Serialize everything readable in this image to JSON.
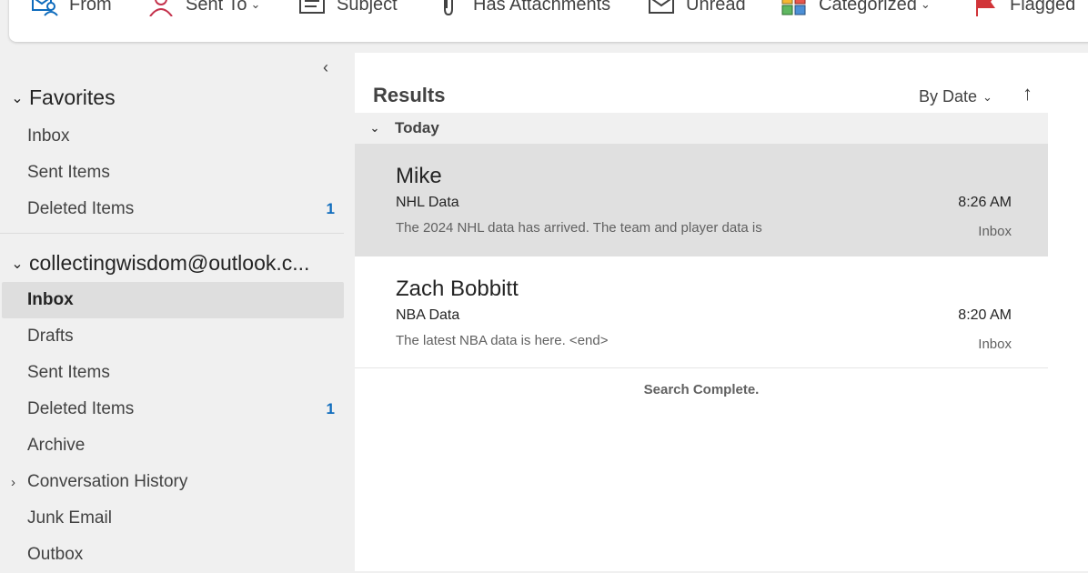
{
  "toolbar": {
    "filters": [
      {
        "label": "From",
        "icon": "from-icon"
      },
      {
        "label": "Sent To",
        "icon": "person-icon",
        "dropdown": true
      },
      {
        "label": "Subject",
        "icon": "subject-icon"
      },
      {
        "label": "Has Attachments",
        "icon": "paperclip-icon"
      },
      {
        "label": "Unread",
        "icon": "envelope-icon"
      },
      {
        "label": "Categorized",
        "icon": "category-icon",
        "dropdown": true
      },
      {
        "label": "Flagged",
        "icon": "flag-icon"
      }
    ],
    "colors": {
      "accent_red": "#c4314b",
      "flag_red": "#d13438"
    }
  },
  "nav": {
    "favorites": {
      "label": "Favorites",
      "items": [
        {
          "label": "Inbox",
          "count": ""
        },
        {
          "label": "Sent Items",
          "count": ""
        },
        {
          "label": "Deleted Items",
          "count": "1"
        }
      ]
    },
    "account": {
      "label": "collectingwisdom@outlook.c...",
      "items": [
        {
          "label": "Inbox",
          "count": ""
        },
        {
          "label": "Drafts",
          "count": ""
        },
        {
          "label": "Sent Items",
          "count": ""
        },
        {
          "label": "Deleted Items",
          "count": "1"
        },
        {
          "label": "Archive",
          "count": ""
        },
        {
          "label": "Conversation History",
          "count": ""
        },
        {
          "label": "Junk Email",
          "count": ""
        },
        {
          "label": "Outbox",
          "count": ""
        }
      ]
    },
    "count_color": "#0f6cbd"
  },
  "list": {
    "title": "Results",
    "sort_label": "By Date",
    "group_label": "Today",
    "messages": [
      {
        "sender": "Mike",
        "subject": "NHL Data",
        "time": "8:26 AM",
        "preview": "The 2024 NHL data has arrived.  The team and player data is",
        "folder": "Inbox"
      },
      {
        "sender": "Zach Bobbitt",
        "subject": "NBA Data",
        "time": "8:20 AM",
        "preview": "The latest NBA data is here. <end>",
        "folder": "Inbox"
      }
    ],
    "status": "Search Complete."
  }
}
